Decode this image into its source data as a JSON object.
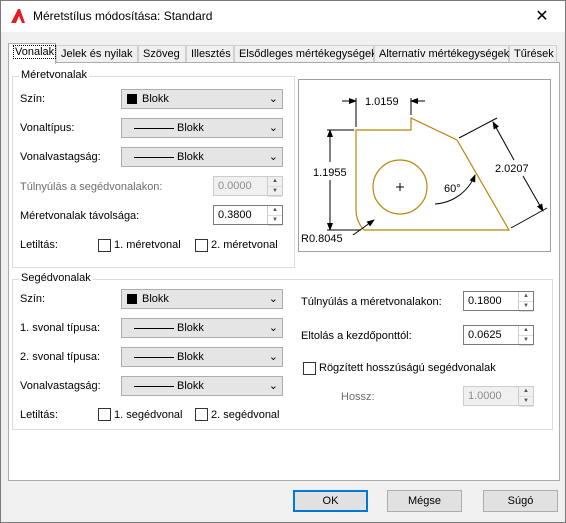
{
  "window": {
    "title": "Méretstílus módosítása: Standard"
  },
  "tabs": [
    {
      "label": "Vonalak"
    },
    {
      "label": "Jelek és nyilak"
    },
    {
      "label": "Szöveg"
    },
    {
      "label": "Illesztés"
    },
    {
      "label": "Elsődleges mértékegységek"
    },
    {
      "label": "Alternatív mértékegységek"
    },
    {
      "label": "Tűrések"
    }
  ],
  "dim_lines": {
    "title": "Méretvonalak",
    "color_label": "Szín:",
    "color_value": "Blokk",
    "linetype_label": "Vonaltípus:",
    "linetype_value": "Blokk",
    "lineweight_label": "Vonalvastagság:",
    "lineweight_value": "Blokk",
    "extend_label": "Túlnyúlás a segédvonalakon:",
    "extend_value": "0.0000",
    "spacing_label": "Méretvonalak távolsága:",
    "spacing_value": "0.3800",
    "suppress_label": "Letiltás:",
    "suppress1": "1. méretvonal",
    "suppress2": "2. méretvonal"
  },
  "ext_lines": {
    "title": "Segédvonalak",
    "color_label": "Szín:",
    "color_value": "Blokk",
    "lt1_label": "1. svonal típusa:",
    "lt1_value": "Blokk",
    "lt2_label": "2. svonal típusa:",
    "lt2_value": "Blokk",
    "lineweight_label": "Vonalvastagság:",
    "lineweight_value": "Blokk",
    "suppress_label": "Letiltás:",
    "suppress1": "1. segédvonal",
    "suppress2": "2. segédvonal",
    "extend_label": "Túlnyúlás a méretvonalakon:",
    "extend_value": "0.1800",
    "offset_label": "Eltolás a kezdőponttól:",
    "offset_value": "0.0625",
    "fixed_label": "Rögzített hosszúságú segédvonalak",
    "length_label": "Hossz:",
    "length_value": "1.0000"
  },
  "preview": {
    "dim_top": "1.0159",
    "dim_left": "1.1955",
    "dim_right": "2.0207",
    "angle": "60°",
    "radius": "R0.8045"
  },
  "buttons": {
    "ok": "OK",
    "cancel": "Mégse",
    "help": "Súgó"
  }
}
